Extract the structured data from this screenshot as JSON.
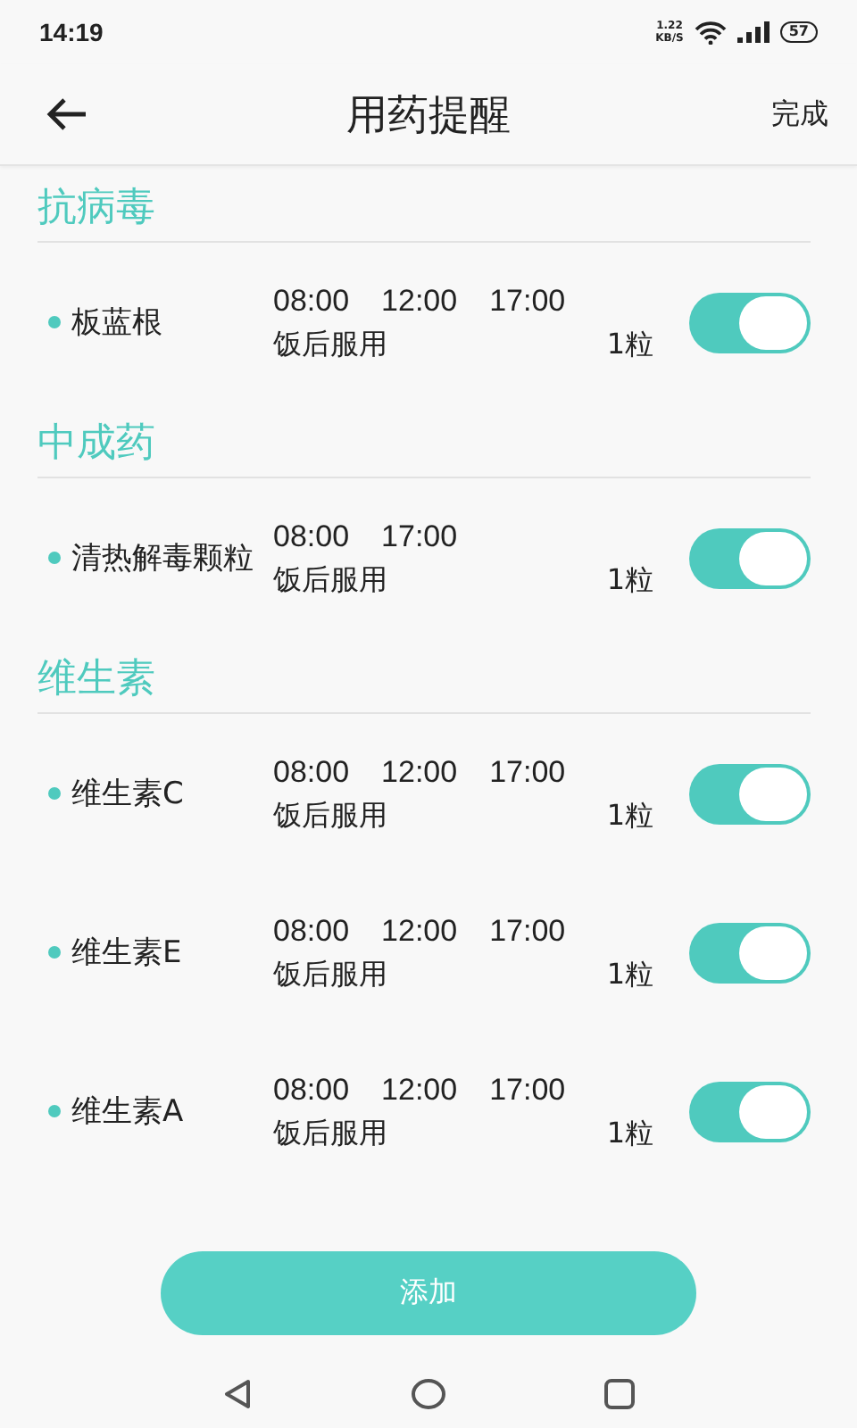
{
  "status_bar": {
    "time": "14:19",
    "speed": "1.22",
    "speed_unit": "KB/S",
    "battery": "57"
  },
  "header": {
    "title": "用药提醒",
    "done": "完成"
  },
  "sections": [
    {
      "title": "抗病毒",
      "items": [
        {
          "name": "板蓝根",
          "times": [
            "08:00",
            "12:00",
            "17:00"
          ],
          "note": "饭后服用",
          "dose": "1粒",
          "on": true
        }
      ]
    },
    {
      "title": "中成药",
      "items": [
        {
          "name": "清热解毒颗粒",
          "times": [
            "08:00",
            "17:00"
          ],
          "note": "饭后服用",
          "dose": "1粒",
          "on": true
        }
      ]
    },
    {
      "title": "维生素",
      "items": [
        {
          "name": "维生素C",
          "times": [
            "08:00",
            "12:00",
            "17:00"
          ],
          "note": "饭后服用",
          "dose": "1粒",
          "on": true
        },
        {
          "name": "维生素E",
          "times": [
            "08:00",
            "12:00",
            "17:00"
          ],
          "note": "饭后服用",
          "dose": "1粒",
          "on": true
        },
        {
          "name": "维生素A",
          "times": [
            "08:00",
            "12:00",
            "17:00"
          ],
          "note": "饭后服用",
          "dose": "1粒",
          "on": true
        }
      ]
    }
  ],
  "add_button": "添加"
}
